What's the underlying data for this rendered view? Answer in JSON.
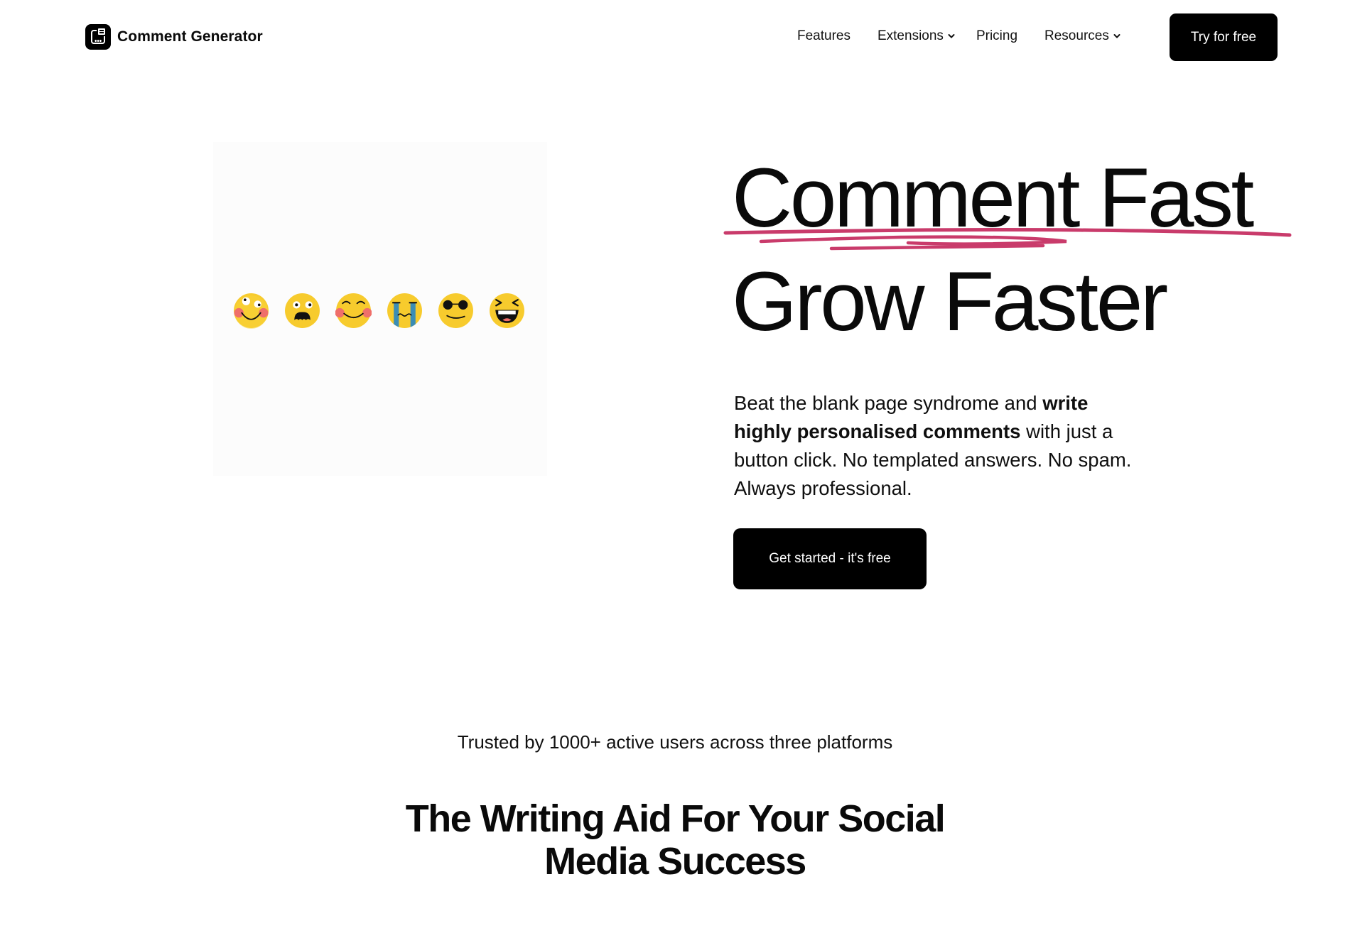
{
  "brand": {
    "name": "Comment Generator",
    "logo_icon": "chat-bubble-device-icon"
  },
  "nav": {
    "items": [
      {
        "label": "Features",
        "has_dropdown": false
      },
      {
        "label": "Extensions",
        "has_dropdown": true,
        "icon": "chevron-down-icon"
      },
      {
        "label": "Pricing",
        "has_dropdown": false
      },
      {
        "label": "Resources",
        "has_dropdown": true,
        "icon": "chevron-down-icon"
      }
    ],
    "cta_label": "Try for free"
  },
  "hero": {
    "headline_line1": "Comment Fast",
    "headline_line2": "Grow Faster",
    "underline_color": "#c93b6b",
    "copy_before": "Beat the blank page syndrome and ",
    "copy_bold": "write highly personalised comments",
    "copy_after": " with just a button click. No templated answers. No spam. Always professional.",
    "cta_label": "Get started - it's free",
    "illustration": {
      "emojis": [
        "blushing-rolling-eyes-emoji",
        "shocked-emoji",
        "happy-blushing-emoji",
        "crying-emoji",
        "sunglasses-smirk-emoji",
        "laughing-squint-emoji"
      ]
    }
  },
  "social_proof": {
    "text": "Trusted by 1000+ active users across three platforms"
  },
  "section": {
    "title_line1": "The Writing Aid For Your Social",
    "title_line2": "Media Success"
  },
  "colors": {
    "primary": "#000000",
    "accent": "#c93b6b",
    "emoji_yellow": "#f7cb2d",
    "blush": "#ef6f6a",
    "tear_blue": "#3b8db5"
  }
}
